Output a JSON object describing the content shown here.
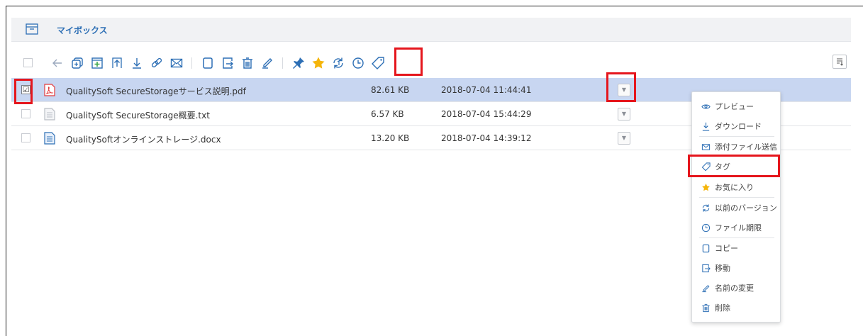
{
  "header": {
    "title": "マイボックス"
  },
  "toolbar": {
    "icons": [
      "select-all-checkbox",
      "back-icon",
      "new-folder-icon",
      "new-file-icon",
      "upload-icon",
      "download-icon",
      "link-icon",
      "mail-icon",
      "copy-icon",
      "move-icon",
      "delete-icon",
      "rename-icon",
      "pin-icon",
      "star-icon",
      "version-icon",
      "clock-icon",
      "tag-icon",
      "sort-icon"
    ]
  },
  "files": [
    {
      "name": "QualitySoft SecureStorageサービス説明.pdf",
      "size": "82.61 KB",
      "date": "2018-07-04 11:44:41",
      "type": "pdf",
      "checked": "☑",
      "selected": true
    },
    {
      "name": "QualitySoft SecureStorage概要.txt",
      "size": "6.57 KB",
      "date": "2018-07-04 15:44:29",
      "type": "txt",
      "checked": "",
      "selected": false
    },
    {
      "name": "QualitySoftオンラインストレージ.docx",
      "size": "13.20 KB",
      "date": "2018-07-04 14:39:12",
      "type": "docx",
      "checked": "",
      "selected": false
    }
  ],
  "menu": {
    "items": [
      {
        "label": "プレビュー",
        "icon": "eye-icon"
      },
      {
        "label": "ダウンロード",
        "icon": "download-icon"
      },
      {
        "label": "添付ファイル送信",
        "icon": "mail-icon"
      },
      {
        "label": "タグ",
        "icon": "tag-icon"
      },
      {
        "label": "お気に入り",
        "icon": "star-icon"
      },
      {
        "label": "以前のバージョン",
        "icon": "version-icon"
      },
      {
        "label": "ファイル期限",
        "icon": "clock-icon"
      },
      {
        "label": "コピー",
        "icon": "copy-icon"
      },
      {
        "label": "移動",
        "icon": "move-icon"
      },
      {
        "label": "名前の変更",
        "icon": "rename-icon"
      },
      {
        "label": "削除",
        "icon": "delete-icon"
      }
    ]
  },
  "colors": {
    "accent": "#2d6fb5",
    "selected_row": "#c8d6f1",
    "highlight": "#e5161d",
    "star": "#f5b50a",
    "pdf": "#e2393b"
  }
}
